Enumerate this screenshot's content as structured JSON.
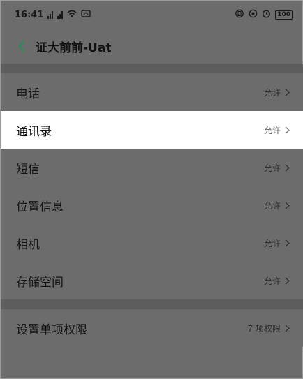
{
  "status_bar": {
    "time": "16:41",
    "signal1": "5il",
    "signal2": "5il",
    "battery": "100"
  },
  "header": {
    "title": "证大前前-Uat"
  },
  "permissions": [
    {
      "label": "电话",
      "value": "允许"
    },
    {
      "label": "通讯录",
      "value": "允许"
    },
    {
      "label": "短信",
      "value": "允许"
    },
    {
      "label": "位置信息",
      "value": "允许"
    },
    {
      "label": "相机",
      "value": "允许"
    },
    {
      "label": "存储空间",
      "value": "允许"
    }
  ],
  "individual": {
    "label": "设置单项权限",
    "value": "7 项权限"
  },
  "colors": {
    "back_arrow": "#2e8b57",
    "overlay": "#6c6c6c",
    "highlight": "#ffffff"
  }
}
